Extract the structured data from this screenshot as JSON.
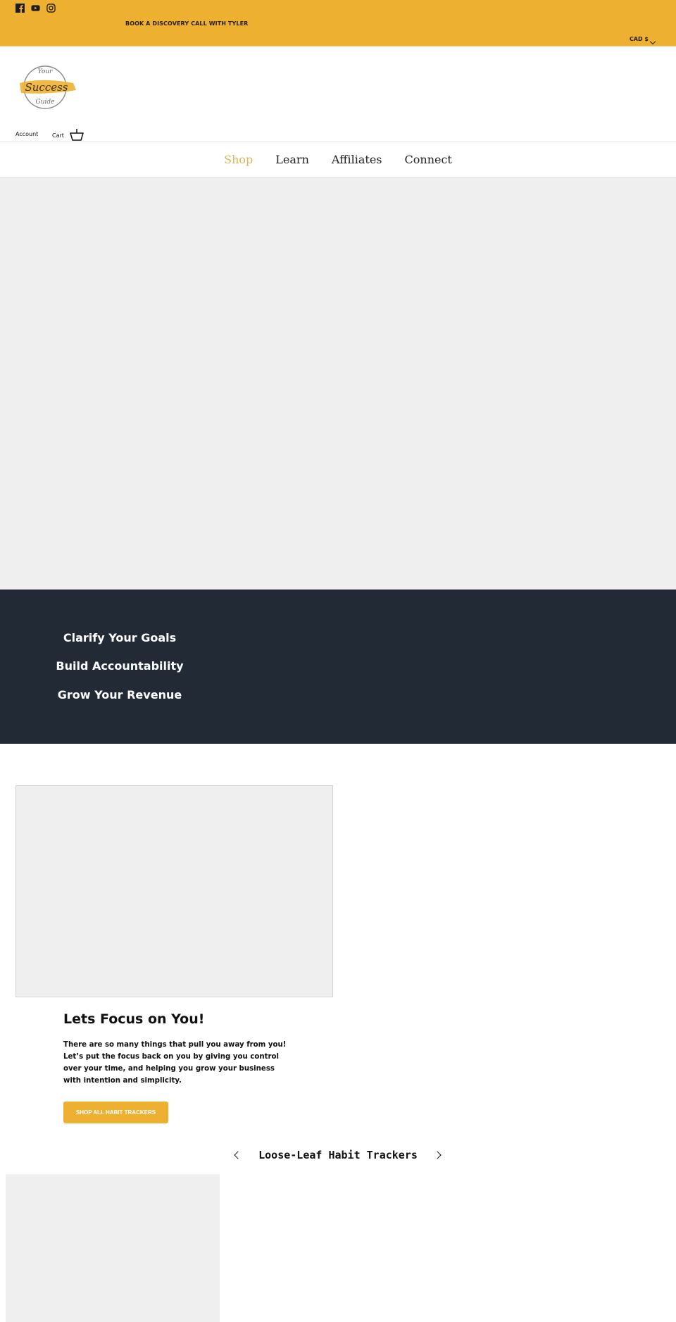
{
  "colors": {
    "accent": "#eeb030",
    "nav_active": "#d9b55a",
    "dark_band": "#212a35",
    "placeholder": "#efefef"
  },
  "topbar": {
    "social_icons": [
      "facebook-icon",
      "youtube-icon",
      "instagram-icon"
    ],
    "announcement": "BOOK A DISCOVERY CALL WITH TYLER",
    "currency": "CAD $"
  },
  "header": {
    "logo_text": {
      "line1": "Your",
      "line2": "Success",
      "line3": "Guide"
    },
    "account_label": "Account",
    "cart_label": "Cart"
  },
  "nav": {
    "items": [
      {
        "label": "Shop",
        "active": true
      },
      {
        "label": "Learn",
        "active": false
      },
      {
        "label": "Affiliates",
        "active": false
      },
      {
        "label": "Connect",
        "active": false
      }
    ]
  },
  "benefits": {
    "items": [
      "Clarify Your Goals",
      "Build Accountability",
      "Grow Your Revenue"
    ]
  },
  "feature": {
    "title": "Lets Focus on You!",
    "body": "There are so many things that pull you away from you! Let’s put the focus back on you by giving you control over your time, and helping you grow your business with intention and simplicity.",
    "cta_label": "SHOP ALL HABIT TRACKERS"
  },
  "carousel": {
    "title": "Loose-Leaf Habit Trackers"
  }
}
